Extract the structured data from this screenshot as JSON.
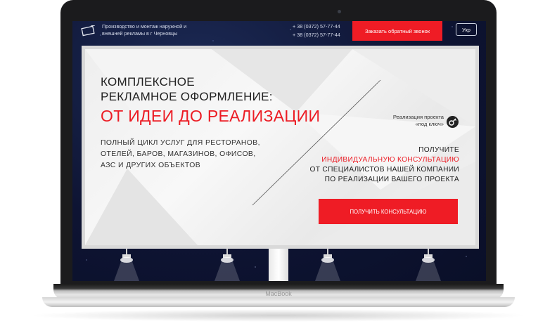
{
  "header": {
    "tagline": "Производство и монтаж наружной и внешней рекламы в г Черновцы",
    "phones": [
      "+ 38 (0372) 57-77-44",
      "+ 38 (0372) 57-77-44"
    ],
    "callback_label": "Заказать обратный звонок",
    "lang_label": "Укр"
  },
  "hero": {
    "headline_line1": "КОМПЛЕКСНОЕ",
    "headline_line2": "РЕКЛАМНОЕ ОФОРМЛЕНИЕ:",
    "headline_red": "ОТ ИДЕИ ДО РЕАЛИЗАЦИИ",
    "description": "ПОЛНЫЙ ЦИКЛ УСЛУГ ДЛЯ РЕСТОРАНОВ, ОТЕЛЕЙ, БАРОВ, МАГАЗИНОВ, ОФИСОВ, АЗС И ДРУГИХ ОБЪЕКТОВ",
    "turnkey_line1": "Реализация проекта",
    "turnkey_line2": "«под ключ»",
    "cta_line1": "ПОЛУЧИТЕ",
    "cta_line2": "ИНДИВИДУАЛЬНУЮ КОНСУЛЬТАЦИЮ",
    "cta_line3": "ОТ СПЕЦИАЛИСТОВ НАШЕЙ КОМПАНИИ",
    "cta_line4": "ПО РЕАЛИЗАЦИИ ВАШЕГО ПРОЕКТА",
    "consult_button": "ПОЛУЧИТЬ КОНСУЛЬТАЦИЮ"
  },
  "device": {
    "brand": "MacBook"
  },
  "colors": {
    "accent": "#ef1c25",
    "night_bg": "#0e1433"
  }
}
